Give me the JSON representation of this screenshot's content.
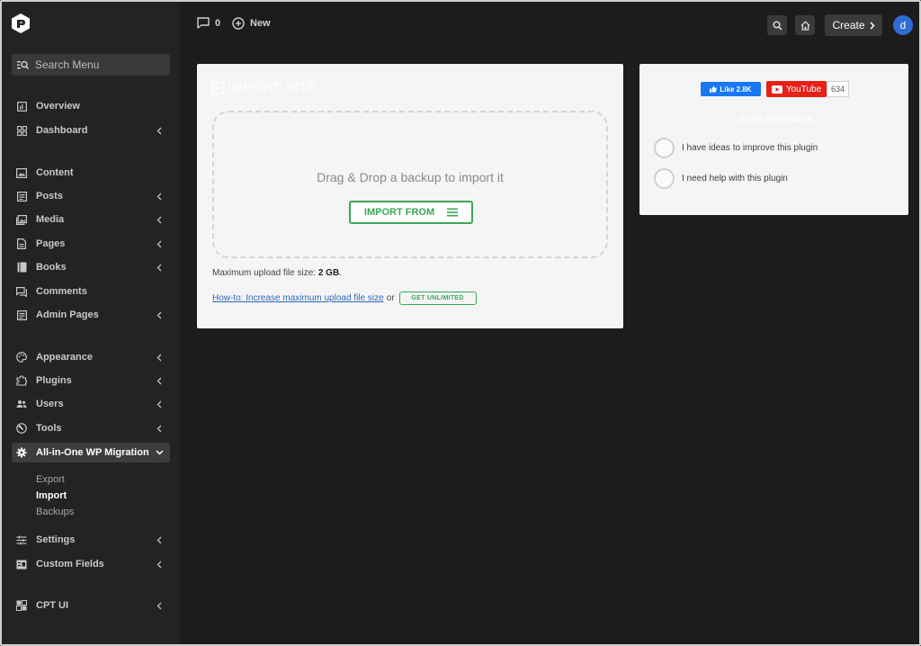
{
  "topbar": {
    "comments_count": "0",
    "new_label": "New",
    "create_label": "Create",
    "avatar_letter": "d"
  },
  "sidebar": {
    "search_placeholder": "Search Menu",
    "items": [
      {
        "label": "Overview",
        "icon": "overview-icon",
        "chevron": false
      },
      {
        "label": "Dashboard",
        "icon": "dashboard-grid-icon",
        "chevron": true
      },
      {
        "label": "Content",
        "icon": "content-icon",
        "chevron": false
      },
      {
        "label": "Posts",
        "icon": "posts-icon",
        "chevron": true
      },
      {
        "label": "Media",
        "icon": "media-icon",
        "chevron": true
      },
      {
        "label": "Pages",
        "icon": "pages-icon",
        "chevron": true
      },
      {
        "label": "Books",
        "icon": "books-icon",
        "chevron": true
      },
      {
        "label": "Comments",
        "icon": "comments-icon",
        "chevron": false
      },
      {
        "label": "Admin Pages",
        "icon": "admin-pages-icon",
        "chevron": true
      },
      {
        "label": "Appearance",
        "icon": "palette-icon",
        "chevron": true
      },
      {
        "label": "Plugins",
        "icon": "plugins-icon",
        "chevron": true
      },
      {
        "label": "Users",
        "icon": "users-icon",
        "chevron": true
      },
      {
        "label": "Tools",
        "icon": "tools-icon",
        "chevron": true
      },
      {
        "label": "All-in-One WP Migration",
        "icon": "gear-icon",
        "chevron": true
      },
      {
        "label": "Settings",
        "icon": "settings-sliders-icon",
        "chevron": true
      },
      {
        "label": "Custom Fields",
        "icon": "custom-fields-icon",
        "chevron": true
      },
      {
        "label": "CPT UI",
        "icon": "cpt-ui-icon",
        "chevron": true
      }
    ],
    "submenu": [
      "Export",
      "Import",
      "Backups"
    ],
    "active_submenu": "Import"
  },
  "import_card": {
    "title": "IMPORT SITE",
    "drop_text": "Drag & Drop a backup to import it",
    "import_button": "IMPORT FROM",
    "max_size_prefix": "Maximum upload file size:",
    "max_size_value": "2 GB",
    "max_size_suffix": ".",
    "howto_link": "How-to: Increase maximum upload file size",
    "or_text": "or",
    "get_unlimited": "GET UNLIMITED"
  },
  "feedback_card": {
    "like_label": "Like 2.8K",
    "youtube_label": "YouTube",
    "youtube_count": "634",
    "title": "LEAVE FEEDBACK",
    "options": [
      "I have ideas to improve this plugin",
      "I need help with this plugin"
    ]
  },
  "colors": {
    "accent_green": "#3aa657",
    "facebook_blue": "#1877f2",
    "youtube_red": "#e62117",
    "avatar_blue": "#2f6bd3"
  }
}
